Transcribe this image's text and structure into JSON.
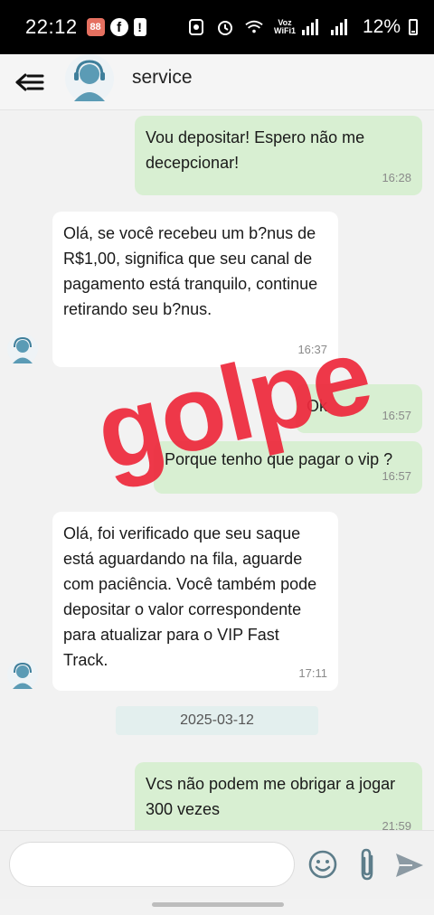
{
  "status_bar": {
    "time": "22:12",
    "battery": "12%",
    "voz_wifi_top": "Voz",
    "voz_wifi_bottom": "WiFi1"
  },
  "header": {
    "title": "service",
    "avatar_icon": "support-agent-icon",
    "back_icon": "back-arrow-icon"
  },
  "messages": [
    {
      "direction": "out",
      "text": "Vou depositar! Espero não me decepcionar!",
      "time": "16:28"
    },
    {
      "direction": "in",
      "text": "Olá, se você recebeu um b?nus de R$1,00, significa que seu canal de pagamento está tranquilo, continue retirando seu b?nus.",
      "time": "16:37"
    },
    {
      "direction": "out",
      "text": "Ok",
      "time": "16:57"
    },
    {
      "direction": "out",
      "text": "Porque tenho que pagar o vip ?",
      "time": "16:57"
    },
    {
      "direction": "in",
      "text": "Olá, foi verificado que seu saque está aguardando na fila, aguarde com paciência. Você também pode depositar o valor correspondente para atualizar para o VIP Fast Track.",
      "time": "17:11"
    },
    {
      "direction": "out",
      "text": "Vcs não podem me obrigar a jogar 300 vezes",
      "time": "21:59"
    }
  ],
  "date_separator": "2025-03-12",
  "watermark": "golpe",
  "input": {
    "value": "",
    "placeholder": ""
  },
  "colors": {
    "outgoing_bubble": "#d8efd2",
    "incoming_bubble": "#ffffff",
    "watermark": "#ee2a3d",
    "avatar_blue": "#5b9bb5"
  }
}
